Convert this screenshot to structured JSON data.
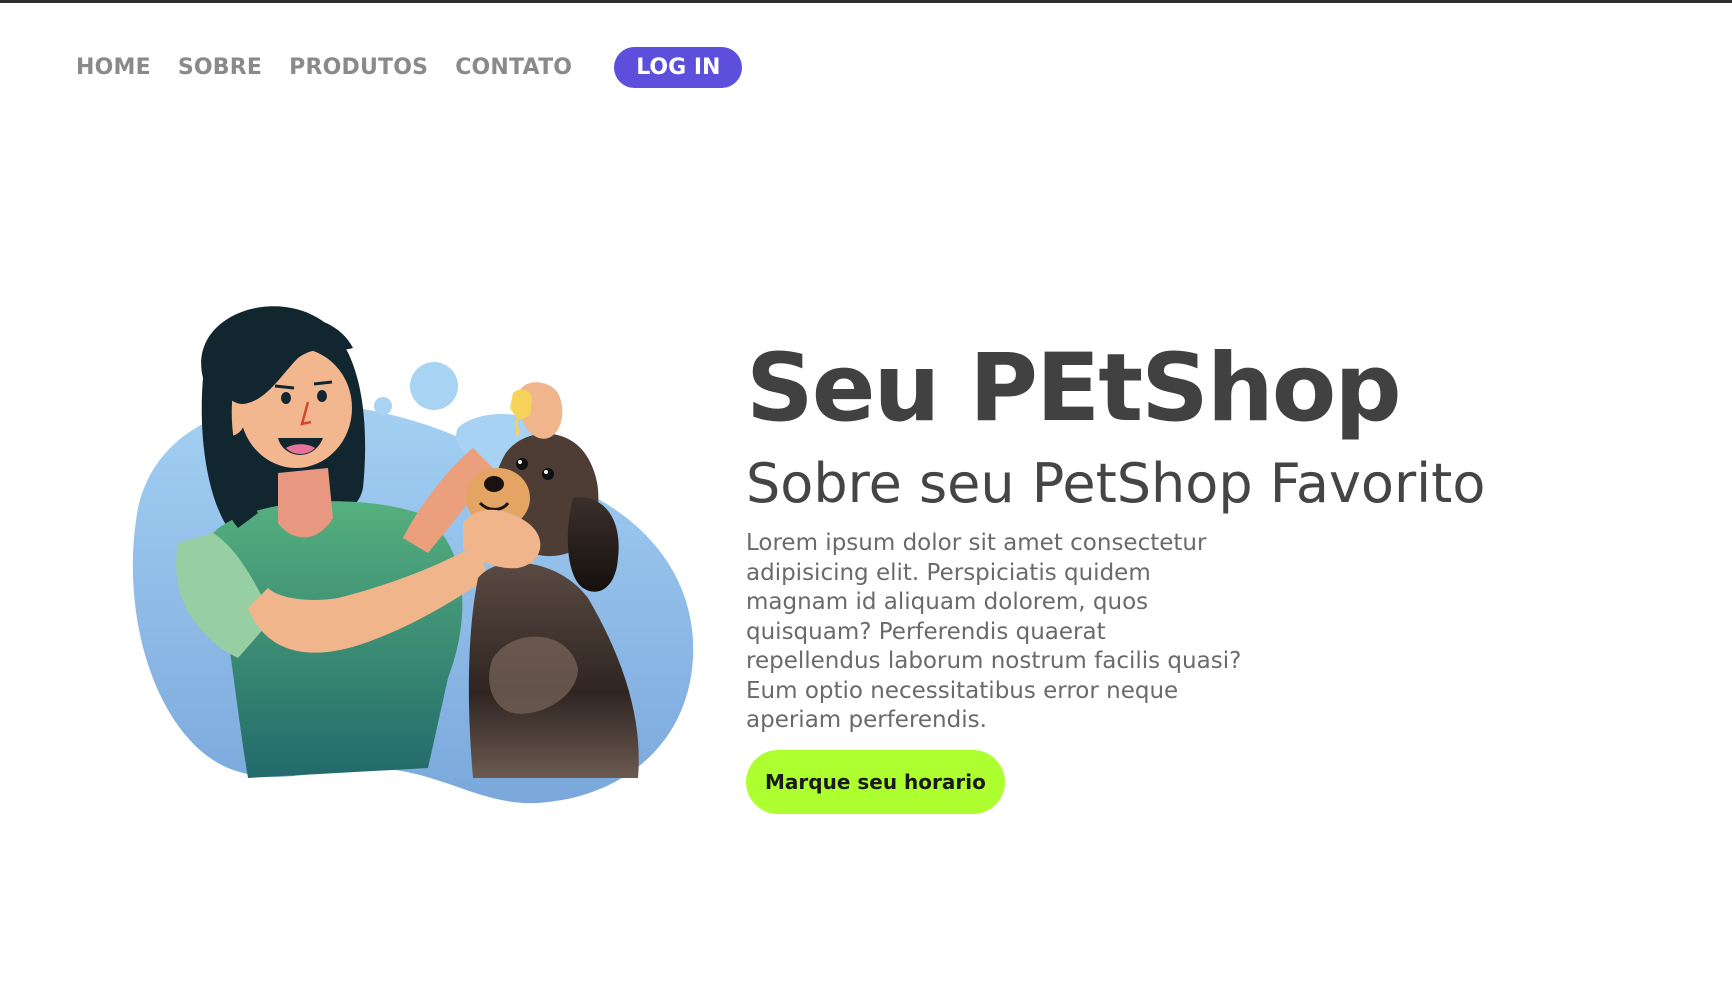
{
  "nav": {
    "links": [
      {
        "label": "HOME"
      },
      {
        "label": "SOBRE"
      },
      {
        "label": "PRODUTOS"
      },
      {
        "label": "CONTATO"
      }
    ],
    "login_label": "LOG IN"
  },
  "hero": {
    "title": "Seu PEtShop",
    "subtitle": "Sobre seu PetShop Favorito",
    "description": "Lorem ipsum dolor sit amet consectetur adipisicing elit. Perspiciatis quidem magnam id aliquam dolorem, quos quisquam? Perferendis quaerat repellendus laborum nostrum facilis quasi? Eum optio necessitatibus error neque aperiam perferendis.",
    "cta_label": "Marque seu horario"
  },
  "colors": {
    "login_bg": "#5b4fdb",
    "cta_bg": "#adff2f",
    "title_text": "#414141",
    "nav_text": "#8a8a8a",
    "blob_blue": "#8fbde8",
    "shirt_green": "#3f9a74",
    "dog_brown": "#4a3b33"
  },
  "illustration": {
    "icon": "vet-with-dog-illustration"
  }
}
